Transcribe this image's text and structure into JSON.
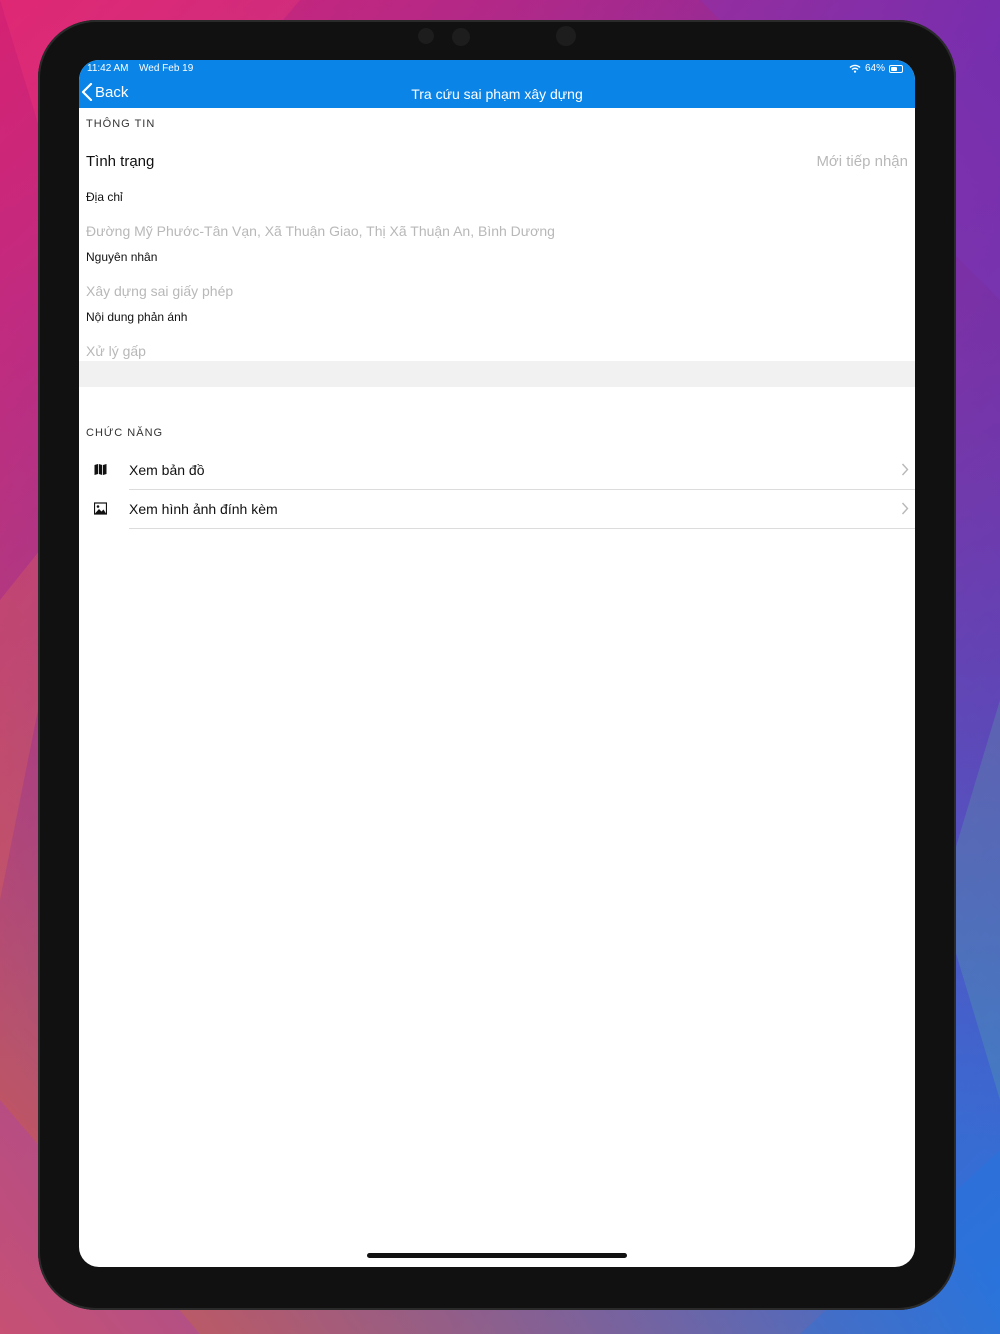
{
  "status_bar": {
    "time": "11:42 AM",
    "date": "Wed Feb 19",
    "battery": "64%",
    "battery_level": 0.64,
    "wifi_icon": "wifi-icon"
  },
  "nav": {
    "back_label": "Back",
    "title": "Tra cứu sai phạm xây dựng"
  },
  "info_section": {
    "header": "THÔNG TIN",
    "status_label": "Tình trạng",
    "status_value": "Mới tiếp nhận",
    "address_label": "Địa chỉ",
    "address_value": "Đường Mỹ Phước-Tân Vạn, Xã Thuận Giao, Thị Xã Thuận An, Bình Dương",
    "cause_label": "Nguyên nhân",
    "cause_value": "Xây dựng sai giấy phép",
    "content_label": "Nội dung phản ánh",
    "content_value": "Xử lý gấp"
  },
  "function_section": {
    "header": "CHỨC NĂNG",
    "items": [
      {
        "label": "Xem bản đồ",
        "icon": "map-icon"
      },
      {
        "label": "Xem hình ảnh đính kèm",
        "icon": "image-icon"
      }
    ]
  },
  "colors": {
    "accent": "#0a84e6",
    "placeholder": "#b8b8b8"
  }
}
